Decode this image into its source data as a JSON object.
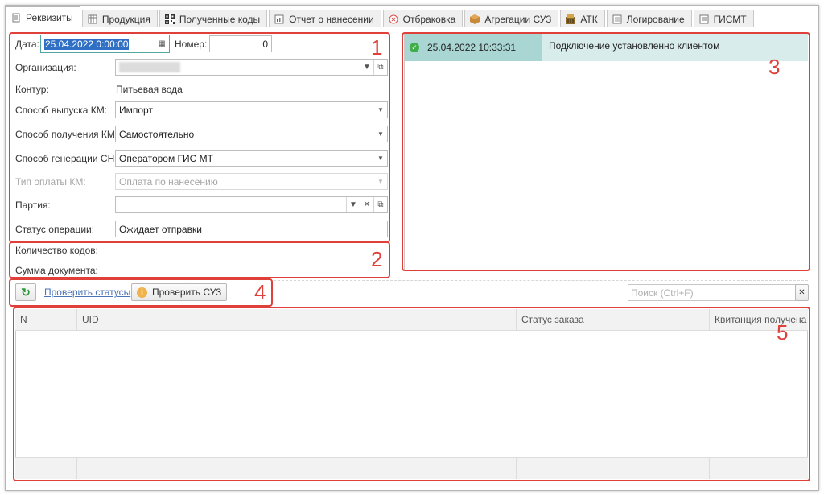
{
  "tabs": [
    {
      "label": "Реквизиты",
      "icon": "document-icon",
      "active": true
    },
    {
      "label": "Продукция",
      "icon": "table-icon"
    },
    {
      "label": "Полученные коды",
      "icon": "qr-code-icon"
    },
    {
      "label": "Отчет о нанесении",
      "icon": "report-icon"
    },
    {
      "label": "Отбраковка",
      "icon": "reject-icon"
    },
    {
      "label": "Агрегации СУЗ",
      "icon": "box-icon"
    },
    {
      "label": "АТК",
      "icon": "atk-icon"
    },
    {
      "label": "Логирование",
      "icon": "log-icon"
    },
    {
      "label": "ГИСМТ",
      "icon": "gismt-icon"
    }
  ],
  "form": {
    "date_label": "Дата:",
    "date_value": "25.04.2022  0:00:00",
    "number_label": "Номер:",
    "number_value": "0",
    "org_label": "Организация:",
    "contour_label": "Контур:",
    "contour_value": "Питьевая вода",
    "release_label": "Способ выпуска КМ:",
    "release_value": "Импорт",
    "receive_label": "Способ получения КМ:",
    "receive_value": "Самостоятельно",
    "generation_label": "Способ генерации СН:",
    "generation_value": "Оператором ГИС МТ",
    "payment_label": "Тип оплаты КМ:",
    "payment_value": "Оплата по нанесению",
    "batch_label": "Партия:",
    "status_label": "Статус операции:",
    "status_value": "Ожидает отправки",
    "codes_count_label": "Количество кодов:",
    "doc_sum_label": "Сумма документа:"
  },
  "log": {
    "rows": [
      {
        "timestamp": "25.04.2022 10:33:31",
        "message": "Подключение установленно клиентом",
        "status_color": "#3fae49"
      }
    ]
  },
  "toolbar": {
    "check_statuses_link": "Проверить статусы",
    "check_suz_button": "Проверить СУЗ",
    "search_placeholder": "Поиск (Ctrl+F)"
  },
  "table": {
    "columns": [
      "N",
      "UID",
      "Статус заказа",
      "Квитанция получена"
    ]
  },
  "annotations": [
    "1",
    "2",
    "3",
    "4",
    "5"
  ],
  "colors": {
    "annotation": "#e0403a",
    "accent_link": "#4a73b8",
    "log_highlight": "#a9d6d3",
    "log_row": "#d9ecec"
  }
}
